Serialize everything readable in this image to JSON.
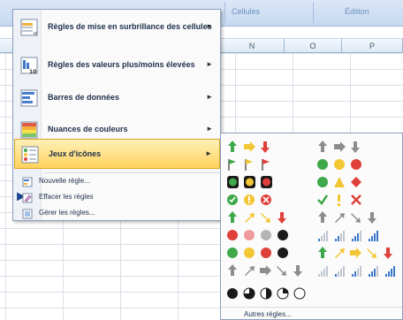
{
  "ribbon": {
    "group_cells": "Cellules",
    "group_edit": "Édition"
  },
  "columns": [
    "N",
    "O",
    "P"
  ],
  "menu": {
    "items": [
      {
        "label": "Règles de mise en surbrillance des cellules",
        "icon": "highlight-cells-rules-icon"
      },
      {
        "label": "Règles des valeurs plus/moins élevées",
        "icon": "top-bottom-rules-icon"
      },
      {
        "label": "Barres de données",
        "icon": "data-bars-icon"
      },
      {
        "label": "Nuances de couleurs",
        "icon": "color-scales-icon"
      },
      {
        "label": "Jeux d'icônes",
        "icon": "icon-sets-icon"
      }
    ],
    "small_items": [
      {
        "label": "Nouvelle règle...",
        "icon": "new-rule-icon"
      },
      {
        "label": "Effacer les règles",
        "icon": "clear-rules-icon"
      },
      {
        "label": "Gérer les règles...",
        "icon": "manage-rules-icon"
      }
    ],
    "submenu_arrow": "►"
  },
  "submenu": {
    "more_label": "Autres règles...",
    "colors": {
      "green": "#3ea84a",
      "yellow": "#f3c634",
      "red": "#e0403a",
      "gray": "#9b9b9b",
      "black": "#1a1a1a"
    }
  }
}
